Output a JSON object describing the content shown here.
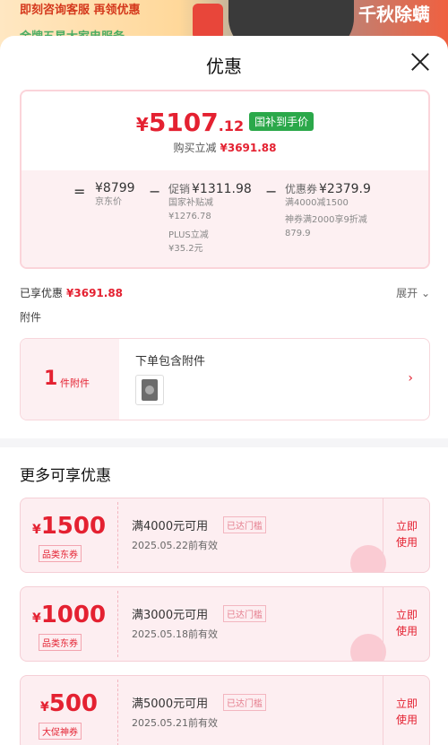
{
  "background": {
    "promo_text": "即刻咨询客服 再领优惠",
    "promo_text_2": "金牌五星大家电服务",
    "right_text": "千秋除螨"
  },
  "header": {
    "title": "优惠",
    "close_icon": "close-icon"
  },
  "summary": {
    "price_yen": "¥",
    "price_int": "5107",
    "price_dec": ".12",
    "price_tag": "国补到手价",
    "saved_label": "购买立减",
    "saved_amount": "¥3691.88",
    "eq": "=",
    "minus": "−",
    "minus2": "−",
    "jd_price": "¥8799",
    "jd_price_label": "京东价",
    "promo_label": "促销",
    "promo_amount": "¥1311.98",
    "promo_sub1": "国家补贴减",
    "promo_sub2": "¥1276.78",
    "promo_sub3": "PLUS立减",
    "promo_sub4": "¥35.2元",
    "coupon_label": "优惠券",
    "coupon_amount": "¥2379.9",
    "coupon_sub1": "满4000减1500",
    "coupon_sub2": "神券满2000享9折减",
    "coupon_sub3": "879.9"
  },
  "shared": {
    "label": "已享优惠",
    "amount": "¥3691.88",
    "expand_label": "展开 ⌄"
  },
  "accessory": {
    "section_label": "附件",
    "count": "1",
    "unit": "件附件",
    "title": "下单包含附件",
    "arrow": "›"
  },
  "more": {
    "title": "更多可享优惠"
  },
  "coupons": [
    {
      "yen": "¥",
      "value": "1500",
      "kind": "品类东券",
      "condition": "满4000元可用",
      "reached": "已达门槛",
      "expiry": "2025.05.22前有效",
      "use": "立即使用"
    },
    {
      "yen": "¥",
      "value": "1000",
      "kind": "品类东券",
      "condition": "满3000元可用",
      "reached": "已达门槛",
      "expiry": "2025.05.18前有效",
      "use": "立即使用"
    },
    {
      "yen": "¥",
      "value": "500",
      "kind": "大促神券",
      "condition": "满5000元可用",
      "reached": "已达门槛",
      "expiry": "2025.05.21前有效",
      "use": "立即使用"
    }
  ],
  "colors": {
    "accent": "#e42131",
    "green_tag": "#2ba84a",
    "pink_bg": "#fdeef1"
  }
}
